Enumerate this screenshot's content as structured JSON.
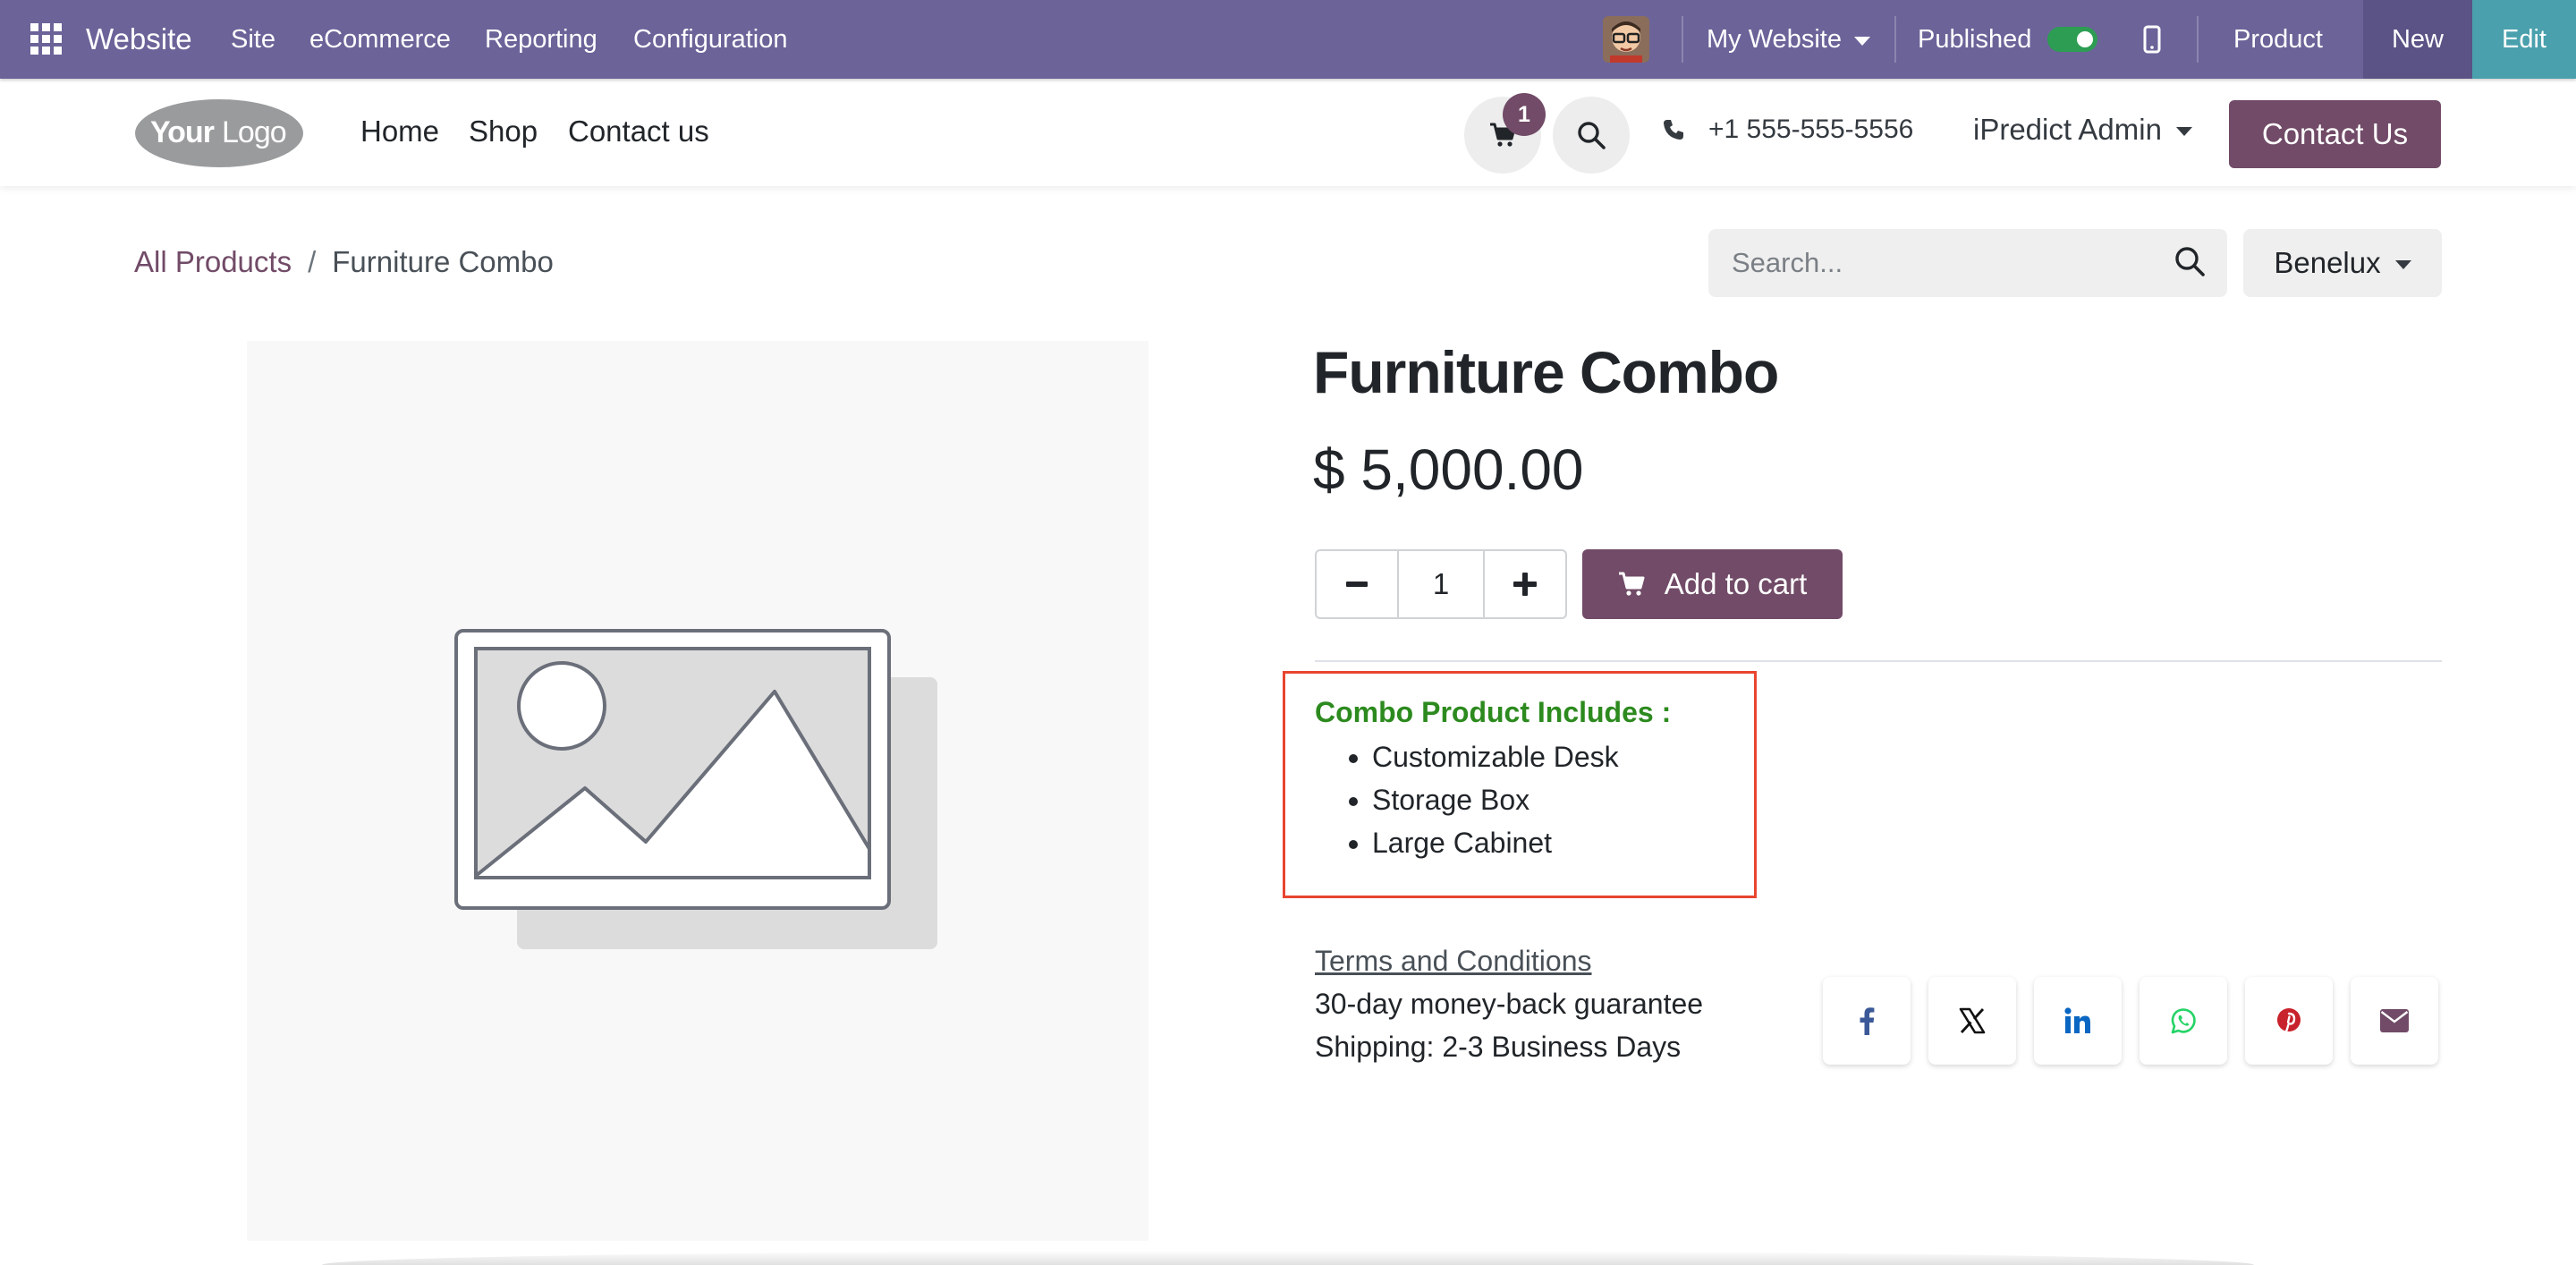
{
  "admin_bar": {
    "app_name": "Website",
    "menus": [
      "Site",
      "eCommerce",
      "Reporting",
      "Configuration"
    ],
    "website_selector": "My Website",
    "published_label": "Published",
    "published_state": true,
    "product_label": "Product",
    "new_label": "New",
    "edit_label": "Edit"
  },
  "header": {
    "logo_text": "YourLogo",
    "nav": [
      "Home",
      "Shop",
      "Contact us"
    ],
    "cart_count": "1",
    "phone": "+1 555-555-5556",
    "user": "iPredict Admin",
    "contact_button": "Contact Us"
  },
  "breadcrumb": {
    "parent": "All Products",
    "separator": "/",
    "current": "Furniture Combo"
  },
  "search": {
    "placeholder": "Search..."
  },
  "pricelist": "Benelux",
  "product": {
    "name": "Furniture Combo",
    "price": "$ 5,000.00",
    "quantity": "1",
    "add_to_cart": "Add to cart",
    "combo_title": "Combo Product Includes :",
    "combo_items": [
      "Customizable Desk",
      "Storage Box",
      "Large Cabinet"
    ],
    "terms": "Terms and Conditions",
    "guarantee": "30-day money-back guarantee",
    "shipping": "Shipping: 2-3 Business Days"
  },
  "share_icons": [
    "facebook-icon",
    "x-icon",
    "linkedin-icon",
    "whatsapp-icon",
    "pinterest-icon",
    "email-icon"
  ],
  "colors": {
    "admin_bar": "#6c6399",
    "primary": "#714b67",
    "edit": "#4aa0ad",
    "combo_title": "#2c8a1e",
    "highlight_border": "#e8452f",
    "facebook": "#3b5998",
    "linkedin": "#0a66c2",
    "whatsapp": "#25d366",
    "pinterest": "#c8232c",
    "email": "#714b67"
  }
}
